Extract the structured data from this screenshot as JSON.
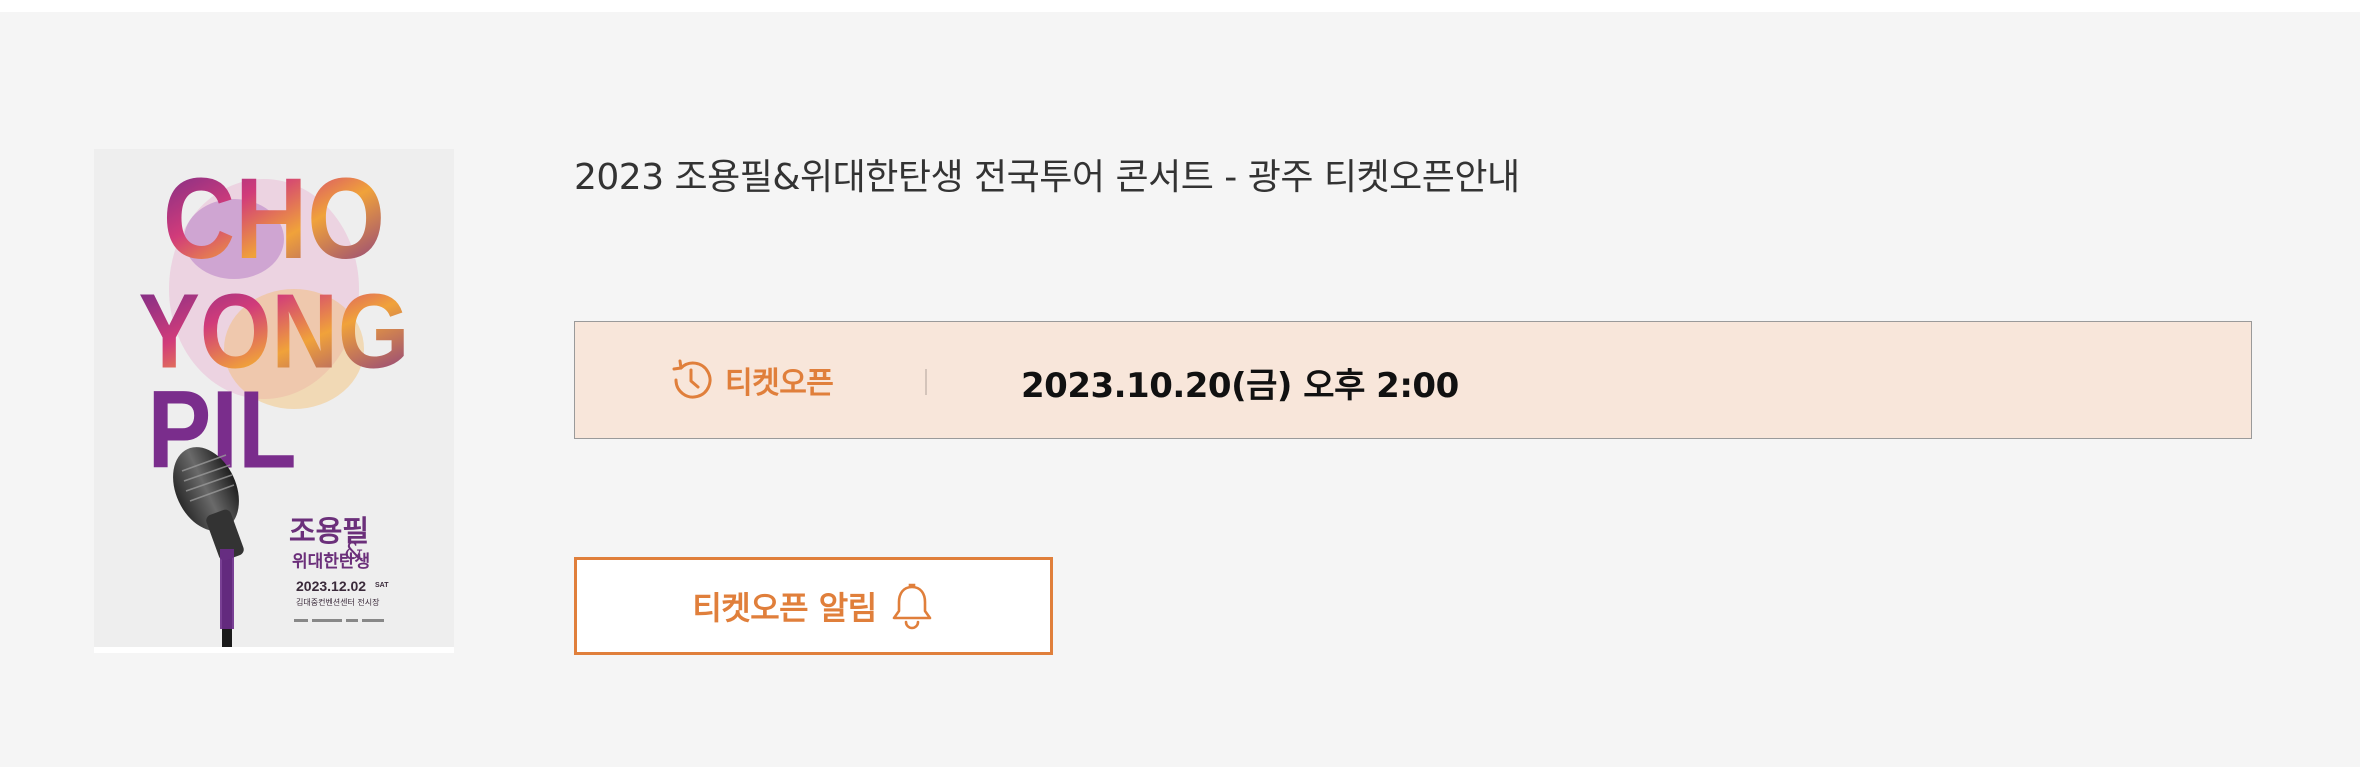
{
  "concert": {
    "title": "2023 조용필&위대한탄생 전국투어 콘서트 - 광주 티켓오픈안내",
    "poster": {
      "artist_lines": [
        "CHO",
        "YONG",
        "PIL"
      ],
      "korean_name": "조용필",
      "ampersand": "&",
      "band_name": "위대한탄생",
      "date": "2023.12.02",
      "day": "SAT",
      "venue": "김대중컨벤션센터 전시장"
    }
  },
  "ticket_open": {
    "label": "티켓오픈",
    "icon": "clock-history-icon",
    "datetime": "2023.10.20(금) 오후 2:00"
  },
  "alarm_button": {
    "label": "티켓오픈 알림",
    "icon": "bell-icon"
  },
  "colors": {
    "accent": "#e07f3b",
    "info_bg": "#f8e6da",
    "panel_bg": "#f5f5f5",
    "poster_purple": "#6b2f7a"
  }
}
